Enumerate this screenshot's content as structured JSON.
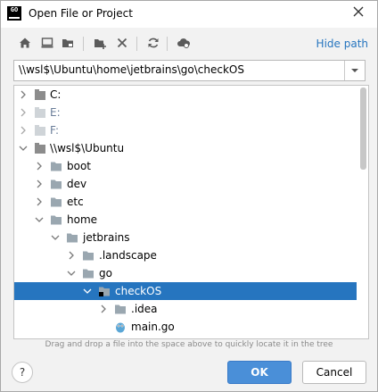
{
  "window": {
    "title": "Open File or Project",
    "app_icon_text": "GO"
  },
  "toolbar": {
    "buttons": [
      "home-icon",
      "desktop-icon",
      "project-folder-icon",
      "new-folder-icon",
      "delete-icon",
      "refresh-icon",
      "cloud-icon"
    ],
    "hide_path_label": "Hide path"
  },
  "path_field": {
    "value": "\\\\wsl$\\Ubuntu\\home\\jetbrains\\go\\checkOS"
  },
  "tree": {
    "rows": [
      {
        "label": "C:",
        "expanded": false,
        "dim": false
      },
      {
        "label": "E:",
        "expanded": false,
        "dim": true
      },
      {
        "label": "F:",
        "expanded": false,
        "dim": true
      },
      {
        "label": "\\\\wsl$\\Ubuntu",
        "expanded": true,
        "dim": false
      },
      {
        "label": "boot",
        "expanded": false,
        "dim": false
      },
      {
        "label": "dev",
        "expanded": false,
        "dim": false
      },
      {
        "label": "etc",
        "expanded": false,
        "dim": false
      },
      {
        "label": "home",
        "expanded": true,
        "dim": false
      },
      {
        "label": "jetbrains",
        "expanded": true,
        "dim": false
      },
      {
        "label": ".landscape",
        "expanded": false,
        "dim": false
      },
      {
        "label": "go",
        "expanded": true,
        "dim": false
      },
      {
        "label": "checkOS",
        "expanded": true,
        "dim": false,
        "selected": true
      },
      {
        "label": ".idea",
        "expanded": false,
        "dim": false
      },
      {
        "label": "main.go",
        "expanded": false,
        "dim": false,
        "file": true
      }
    ]
  },
  "hint_text": "Drag and drop a file into the space above to quickly locate it in the tree",
  "buttons": {
    "help_label": "?",
    "ok_label": "OK",
    "cancel_label": "Cancel"
  },
  "colors": {
    "accent": "#2675bf",
    "ok_button": "#4a8fd8",
    "folder": "#9aa7b0"
  }
}
